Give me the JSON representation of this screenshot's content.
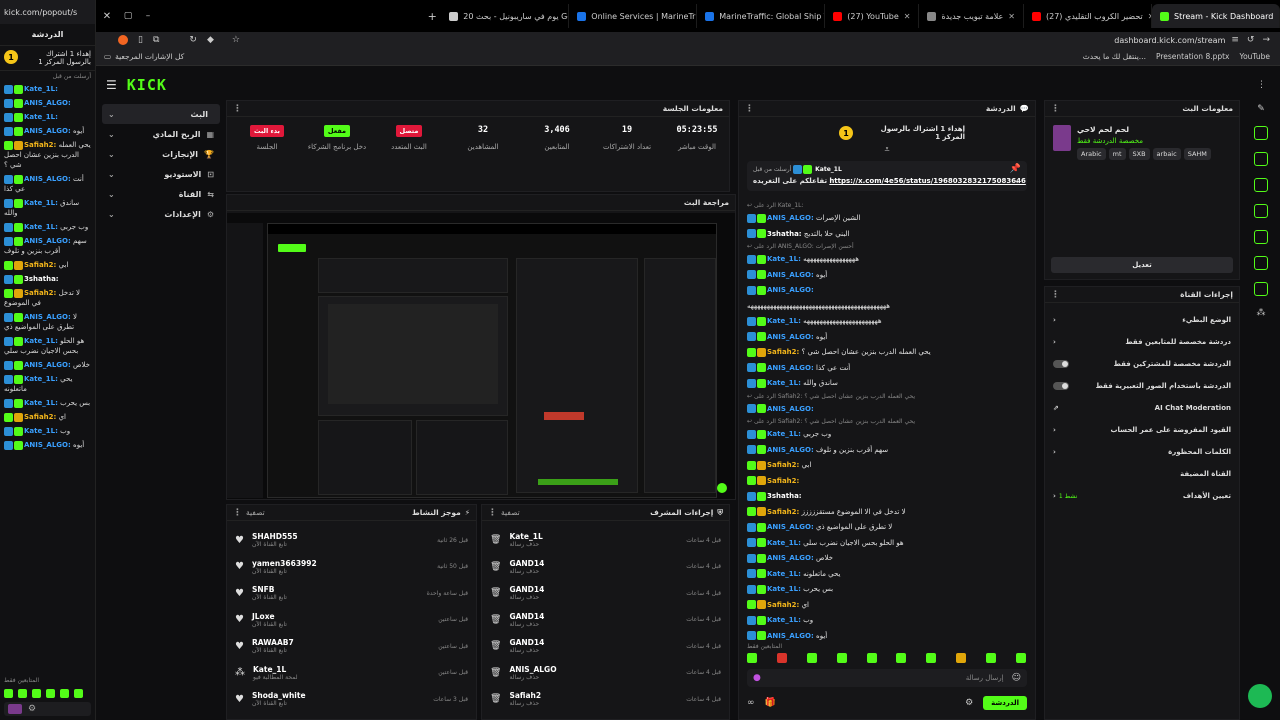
{
  "left_chat": {
    "url": "kick.com/popout/s",
    "header": "الدردشة",
    "pinned_num": "1",
    "pinned_text": "إهداء 1 اشتراك بالرسول المركز 1",
    "pinned_by": "أرسلت من قبل",
    "messages": [
      {
        "user": "Kate_1L:",
        "text": "",
        "cls": "u-blue"
      },
      {
        "user": "ANIS_ALGO:",
        "text": "",
        "cls": "u-blue"
      },
      {
        "user": "Kate_1L:",
        "text": "",
        "cls": "u-blue"
      },
      {
        "user": "ANIS_ALGO:",
        "text": "أيوه",
        "cls": "u-blue"
      },
      {
        "user": "Safiah2:",
        "text": "يحي العمله الدرب بنزين عشان احصل شي ؟",
        "cls": "u-gold"
      },
      {
        "user": "ANIS_ALGO:",
        "text": "أنت عي كذا",
        "cls": "u-blue"
      },
      {
        "user": "Kate_1L:",
        "text": "ساندق والله",
        "cls": "u-blue"
      },
      {
        "user": "Kate_1L:",
        "text": "وب جربي",
        "cls": "u-blue"
      },
      {
        "user": "ANIS_ALGO:",
        "text": "سهم أقرب بنزين و تلوف",
        "cls": "u-blue"
      },
      {
        "user": "Safiah2:",
        "text": "ابي",
        "cls": "u-gold"
      },
      {
        "user": "3shatha:",
        "text": "",
        "cls": "u-white"
      },
      {
        "user": "Safiah2:",
        "text": "لا تدخل في الموضوع",
        "cls": "u-gold"
      },
      {
        "user": "ANIS_ALGO:",
        "text": "لا تطرق على المواضيع ذي",
        "cls": "u-blue"
      },
      {
        "user": "Kate_1L:",
        "text": "هو الحلو بحس الاجيان نضرب سلي",
        "cls": "u-blue"
      },
      {
        "user": "ANIS_ALGO:",
        "text": "خلاص",
        "cls": "u-blue"
      },
      {
        "user": "Kate_1L:",
        "text": "يحي ماتعلونه",
        "cls": "u-blue"
      },
      {
        "user": "Kate_1L:",
        "text": "بس يحرب",
        "cls": "u-blue"
      },
      {
        "user": "Safiah2:",
        "text": "اي",
        "cls": "u-gold"
      },
      {
        "user": "Kate_1L:",
        "text": "وب",
        "cls": "u-blue"
      },
      {
        "user": "ANIS_ALGO:",
        "text": "أيوه",
        "cls": "u-blue"
      }
    ],
    "followers_only": "المتابعين فقط"
  },
  "tabs": [
    {
      "label": "Stream - Kick Dashboard",
      "color": "#53fc18",
      "active": true
    },
    {
      "label": "(27) تحضير الكروب التقليدي",
      "color": "#ff0000"
    },
    {
      "label": "علامة تبويب جديدة",
      "color": "#888"
    },
    {
      "label": "(27) YouTube",
      "color": "#ff0000"
    },
    {
      "label": "MarineTraffic: Global Ship Track",
      "color": "#1a73e8"
    },
    {
      "label": "Online Services | MarineTraffic",
      "color": "#1a73e8"
    },
    {
      "label": "20 يوم في ساريبونيل - بحث Google",
      "color": "#ccc"
    }
  ],
  "address": "dashboard.kick.com/stream",
  "bookmarks": {
    "all": "كل الإشارات المرجعية",
    "items": [
      "YouTube",
      "Presentation 8.pptx",
      "ينتقل لك ما يحدث..."
    ]
  },
  "nav": {
    "logo": "KICK",
    "items": [
      {
        "label": "البث",
        "active": true
      },
      {
        "label": "الربح المادي"
      },
      {
        "label": "الإنجازات"
      },
      {
        "label": "الاستوديو"
      },
      {
        "label": "القناة"
      },
      {
        "label": "الإعدادات"
      }
    ]
  },
  "session": {
    "title": "معلومات الجلسة",
    "stats": [
      {
        "value": "05:23:55",
        "label": "الوقت مباشر"
      },
      {
        "value": "19",
        "label": "تعداد الاشتراكات"
      },
      {
        "value": "3,406",
        "label": "المتابعين"
      },
      {
        "value": "32",
        "label": "المشاهدين"
      },
      {
        "value": "متصل",
        "label": "البث المتعدد",
        "pill": "#e0183a"
      },
      {
        "value": "مفعل",
        "label": "دخل برنامج الشركاء",
        "pill": "#53fc18"
      },
      {
        "value": "بدء البث",
        "label": "الجلسة",
        "pill": "#e0183a"
      }
    ]
  },
  "preview": {
    "title": "مراجعة البث"
  },
  "activity": {
    "title": "موجز النشاط",
    "filter": "تصفية",
    "rows": [
      {
        "name": "SHAHD555",
        "sub": "تابع القناة الآن",
        "time": "قبل 26 ثانية"
      },
      {
        "name": "yamen3663992",
        "sub": "تابع القناة الآن",
        "time": "قبل 50 ثانية"
      },
      {
        "name": "SNFB",
        "sub": "تابع القناة الآن",
        "time": "قبل ساعة واحدة"
      },
      {
        "name": "JLoxe",
        "sub": "تابع القناة الآن",
        "time": "قبل ساعتين"
      },
      {
        "name": "RAWAAB7",
        "sub": "تابع القناة الآن",
        "time": "قبل ساعتين"
      },
      {
        "name": "Kate_1L",
        "sub": "لمحة المطالبة فيو",
        "time": "قبل ساعتين"
      },
      {
        "name": "Shoda_white",
        "sub": "تابع القناة الآن",
        "time": "قبل 3 ساعات"
      }
    ]
  },
  "mod": {
    "title": "إجراءات المشرف",
    "filter": "تصفية",
    "rows": [
      {
        "name": "Kate_1L",
        "sub": "حذف رسالة",
        "time": "قبل 4 ساعات"
      },
      {
        "name": "GAND14",
        "sub": "حذف رسالة",
        "time": "قبل 4 ساعات"
      },
      {
        "name": "GAND14",
        "sub": "حذف رسالة",
        "time": "قبل 4 ساعات"
      },
      {
        "name": "GAND14",
        "sub": "حذف رسالة",
        "time": "قبل 4 ساعات"
      },
      {
        "name": "GAND14",
        "sub": "حذف رسالة",
        "time": "قبل 4 ساعات"
      },
      {
        "name": "ANIS_ALGO",
        "sub": "حذف رسالة",
        "time": "قبل 4 ساعات"
      },
      {
        "name": "Safiah2",
        "sub": "حذف رسالة",
        "time": "قبل 4 ساعات"
      }
    ]
  },
  "chat": {
    "title": "الدردشة",
    "pinned_num": "1",
    "pinned_text": "إهداء 1 اشتراك بالرسول المركز 1",
    "pinned_by": "أرسلت من قبل",
    "pinned_user": "Kate_1L",
    "pinned_link": "https://x.com/4e56/status/1968032832175083646",
    "pinned_caption": "تفاعلكم على التغريده",
    "lines": [
      {
        "reply": "الرد على Kate_1L:"
      },
      {
        "user": "ANIS_ALGO:",
        "text": "الشين الإصرات",
        "cls": "u-blue"
      },
      {
        "user": "3shatha:",
        "text": "البني حلا بالتدبج",
        "cls": "u-white"
      },
      {
        "reply": "الرد على ANIS_ALGO: أحسن الإصرات"
      },
      {
        "user": "Kate_1L:",
        "text": "ههههههههههههههههه",
        "cls": "u-blue"
      },
      {
        "user": "ANIS_ALGO:",
        "text": "أيوه",
        "cls": "u-blue"
      },
      {
        "user": "ANIS_ALGO:",
        "text": "",
        "cls": "u-blue"
      },
      {
        "user": "",
        "text": "هههههههههههههههههههههههههههههههههههههههههههه",
        "cls": "u-white"
      },
      {
        "user": "Kate_1L:",
        "text": "هههههههههههههههههههههههه",
        "cls": "u-blue"
      },
      {
        "user": "ANIS_ALGO:",
        "text": "أيوه",
        "cls": "u-blue"
      },
      {
        "user": "Safiah2:",
        "text": "يحي العمله الدرب بنزين عشان احصل شي ؟",
        "cls": "u-gold"
      },
      {
        "user": "ANIS_ALGO:",
        "text": "أنت عي كذا",
        "cls": "u-blue"
      },
      {
        "user": "Kate_1L:",
        "text": "ساندق والله",
        "cls": "u-blue"
      },
      {
        "reply": "الرد على Safiah2: يحي العمله الدرب بنزين عشان احصل شي ؟"
      },
      {
        "user": "ANIS_ALGO:",
        "text": "",
        "cls": "u-blue"
      },
      {
        "reply": "الرد على Safiah2: يحي العمله الدرب بنزين عشان احصل شي ؟"
      },
      {
        "user": "Kate_1L:",
        "text": "وب جربي",
        "cls": "u-blue"
      },
      {
        "user": "ANIS_ALGO:",
        "text": "سهم أقرب بنزين و تلوف",
        "cls": "u-blue"
      },
      {
        "user": "Safiah2:",
        "text": "ابي",
        "cls": "u-gold"
      },
      {
        "user": "Safiah2:",
        "text": "",
        "cls": "u-gold"
      },
      {
        "user": "3shatha:",
        "text": "",
        "cls": "u-white"
      },
      {
        "user": "Safiah2:",
        "text": "لا تدخل في الا الموضوع مستقززززز",
        "cls": "u-gold"
      },
      {
        "user": "ANIS_ALGO:",
        "text": "لا تطرق على المواضيع ذي",
        "cls": "u-blue"
      },
      {
        "user": "Kate_1L:",
        "text": "هو الحلو بحس الاجيان نضرب سلي",
        "cls": "u-blue"
      },
      {
        "user": "ANIS_ALGO:",
        "text": "خلاص",
        "cls": "u-blue"
      },
      {
        "user": "Kate_1L:",
        "text": "يحي ماتعلونه",
        "cls": "u-blue"
      },
      {
        "user": "Kate_1L:",
        "text": "بس يحرب",
        "cls": "u-blue"
      },
      {
        "user": "Safiah2:",
        "text": "اي",
        "cls": "u-gold"
      },
      {
        "user": "Kate_1L:",
        "text": "وب",
        "cls": "u-blue"
      },
      {
        "user": "ANIS_ALGO:",
        "text": "أيوه",
        "cls": "u-blue"
      }
    ],
    "followers_only": "المتابعين فقط",
    "input_placeholder": "إرسال رسالة",
    "send": "الدردشة"
  },
  "stream_info": {
    "title": "معلومات البث",
    "stream_title": "لحم لحم لاحي",
    "category": "مخصصة الدردشة فقط",
    "tags": [
      "Arabic",
      "mt",
      "SXB",
      "arbaic",
      "SAHM"
    ],
    "edit": "تعديل"
  },
  "channel_actions": {
    "title": "إجراءات القناة",
    "rows": [
      {
        "label": "الوضع البطيء",
        "kind": "chevron"
      },
      {
        "label": "دردشة مخصصة للمتابعين فقط",
        "kind": "chevron"
      },
      {
        "label": "الدردشة مخصصة للمشتركين فقط",
        "kind": "toggle"
      },
      {
        "label": "الدردشة باستخدام الصور التعبيرية فقط",
        "kind": "toggle"
      },
      {
        "label": "AI Chat Moderation",
        "kind": "link"
      },
      {
        "label": "القيود المفروضة على عمر الحساب",
        "kind": "chevron"
      },
      {
        "label": "الكلمات المحظورة",
        "kind": "chevron"
      },
      {
        "label": "القناة المضيفة",
        "kind": "none"
      },
      {
        "label": "تعيين الأهداف",
        "kind": "goal",
        "extra": "نشط 1"
      }
    ]
  },
  "colors": {
    "accent": "#53fc18",
    "bg": "#0e0e10",
    "panel": "#151517"
  }
}
